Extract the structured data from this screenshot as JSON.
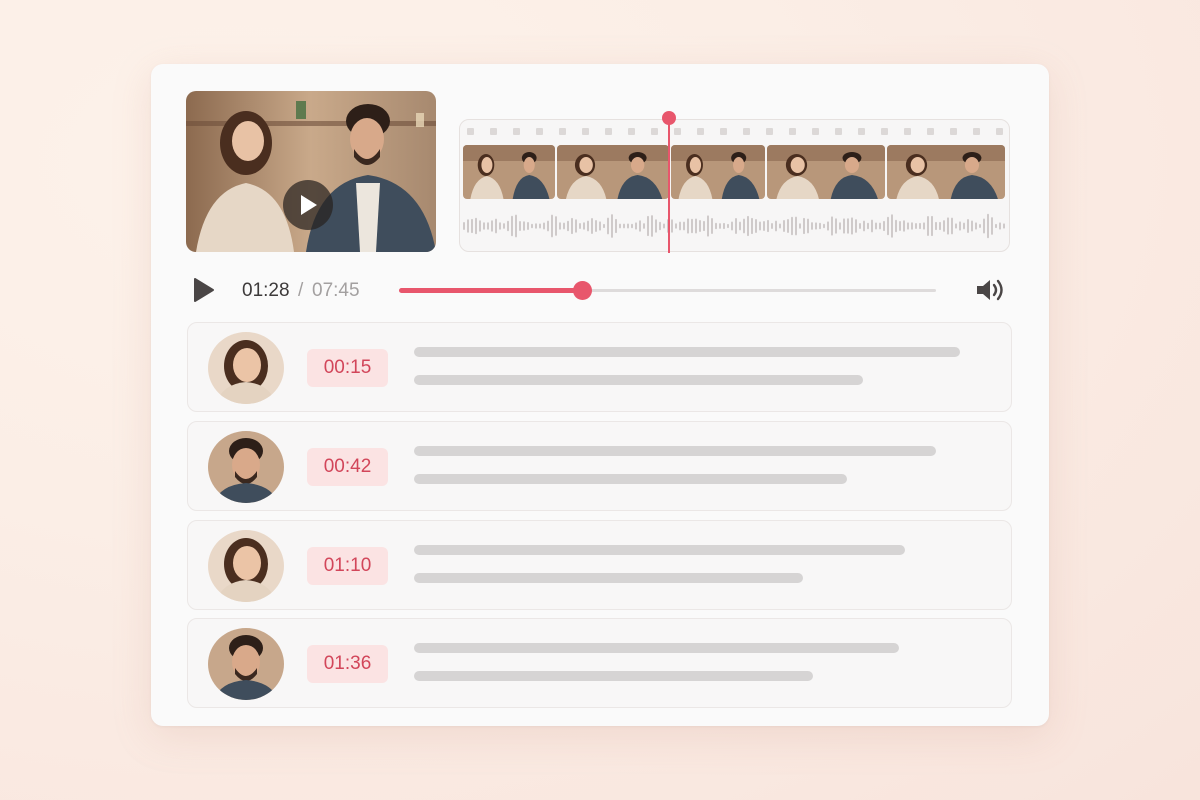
{
  "player": {
    "current_time": "01:28",
    "separator": "/",
    "total_time": "07:45",
    "progress": 0.34,
    "timeline_playhead": 0.38,
    "play_icon": "play-icon",
    "volume_icon": "volume-icon"
  },
  "colors": {
    "accent": "#e8566c",
    "timestamp_bg": "#fbe3e3",
    "timestamp_text": "#d2465a",
    "placeholder_line": "#d6d4d4"
  },
  "transcript": {
    "segments": [
      {
        "speaker": "woman",
        "timestamp": "00:15"
      },
      {
        "speaker": "man",
        "timestamp": "00:42"
      },
      {
        "speaker": "woman",
        "timestamp": "01:10"
      },
      {
        "speaker": "man",
        "timestamp": "01:36"
      }
    ]
  }
}
